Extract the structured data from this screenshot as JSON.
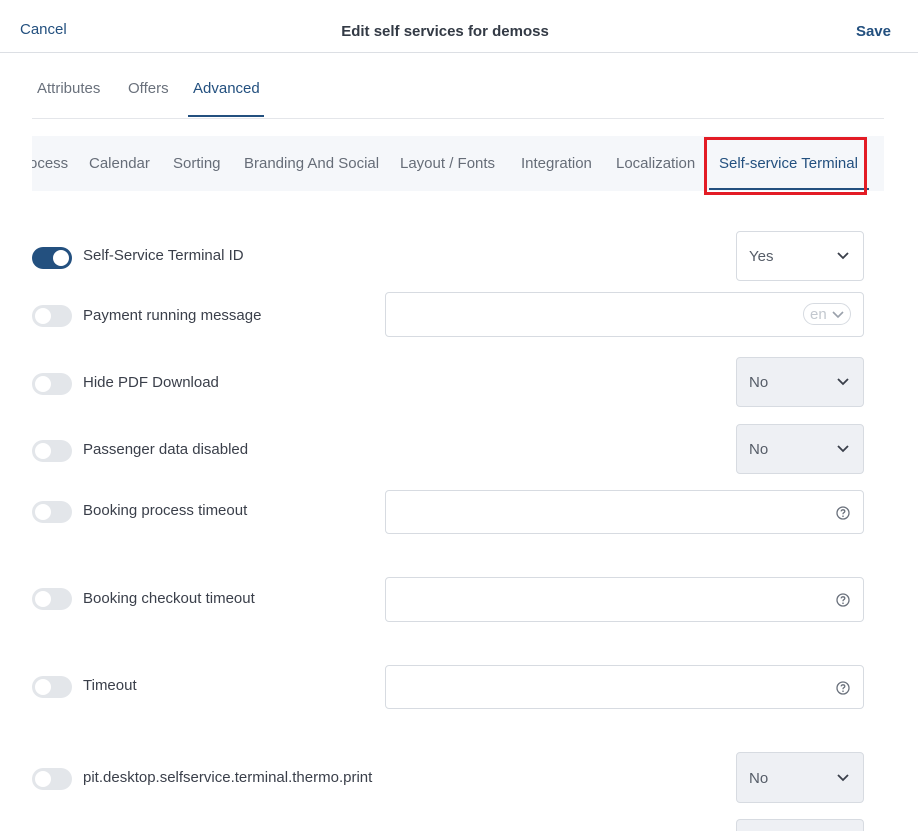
{
  "header": {
    "cancel": "Cancel",
    "title": "Edit self services for demoss",
    "save": "Save"
  },
  "main_tabs": [
    {
      "label": "Attributes"
    },
    {
      "label": "Offers"
    },
    {
      "label": "Advanced",
      "active": true
    }
  ],
  "sub_tabs": [
    {
      "label": "ocess"
    },
    {
      "label": "Calendar"
    },
    {
      "label": "Sorting"
    },
    {
      "label": "Branding And Social"
    },
    {
      "label": "Layout / Fonts"
    },
    {
      "label": "Integration"
    },
    {
      "label": "Localization"
    },
    {
      "label": "Self-service Terminal",
      "active": true
    }
  ],
  "settings": [
    {
      "label": "Self-Service Terminal ID",
      "enabled": true,
      "control": "select",
      "value": "Yes"
    },
    {
      "label": "Payment running message",
      "enabled": false,
      "control": "text-lang",
      "value": "",
      "lang": "en"
    },
    {
      "label": "Hide PDF Download",
      "enabled": false,
      "control": "select",
      "value": "No"
    },
    {
      "label": "Passenger data disabled",
      "enabled": false,
      "control": "select",
      "value": "No"
    },
    {
      "label": "Booking process timeout",
      "enabled": false,
      "control": "text-help",
      "value": ""
    },
    {
      "label": "Booking checkout timeout",
      "enabled": false,
      "control": "text-help",
      "value": ""
    },
    {
      "label": "Timeout",
      "enabled": false,
      "control": "text-help",
      "value": ""
    },
    {
      "label": "pit.desktop.selfservice.terminal.thermo.print",
      "enabled": false,
      "control": "select",
      "value": "No"
    }
  ],
  "colors": {
    "accent": "#23507f",
    "highlight": "#e31c25",
    "toggle_off": "#e3e6ea"
  },
  "icons": {
    "select_arrow": "chevron-down-icon",
    "help": "help-circle-icon"
  }
}
